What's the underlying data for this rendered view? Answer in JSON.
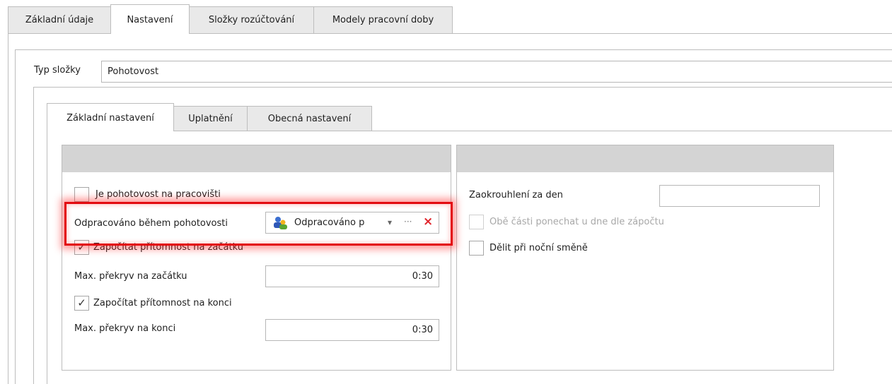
{
  "top_tabs": [
    {
      "label": "Základní údaje",
      "active": false
    },
    {
      "label": "Nastavení",
      "active": true
    },
    {
      "label": "Složky rozúčtování",
      "active": false
    },
    {
      "label": "Modely pracovní doby",
      "active": false
    }
  ],
  "type_field": {
    "label": "Typ složky",
    "value": "Pohotovost"
  },
  "inner_tabs": [
    {
      "label": "Základní nastavení",
      "active": true
    },
    {
      "label": "Uplatnění",
      "active": false
    },
    {
      "label": "Obecná nastavení",
      "active": false
    }
  ],
  "left_panel": {
    "on_site": {
      "label": "Je pohotovost na pracovišti",
      "checked": false,
      "check_glyph": ""
    },
    "worked_during": {
      "label": "Odpracováno během pohotovosti",
      "value": "Odpracováno p",
      "dropdown_glyph": "▾",
      "ellipsis_glyph": "···",
      "clear_glyph": "×"
    },
    "count_start": {
      "label": "Započítat přítomnost na začátku",
      "checked": true,
      "check_glyph": "✓"
    },
    "max_overlap_start": {
      "label": "Max. překryv na začátku",
      "value": "0:30"
    },
    "count_end": {
      "label": "Započítat přítomnost na konci",
      "checked": true,
      "check_glyph": "✓"
    },
    "max_overlap_end": {
      "label": "Max. překryv na konci",
      "value": "0:30"
    }
  },
  "right_panel": {
    "rounding": {
      "label": "Zaokrouhlení za den",
      "value": ""
    },
    "keep_both": {
      "label": "Obě části ponechat u dne dle zápočtu",
      "checked": false,
      "disabled": true,
      "check_glyph": ""
    },
    "split_night": {
      "label": "Dělit při noční směně",
      "checked": false,
      "check_glyph": ""
    }
  },
  "colors": {
    "highlight": "#e30b10",
    "clear_icon": "#e0242b",
    "panel_header": "#d4d4d4"
  }
}
